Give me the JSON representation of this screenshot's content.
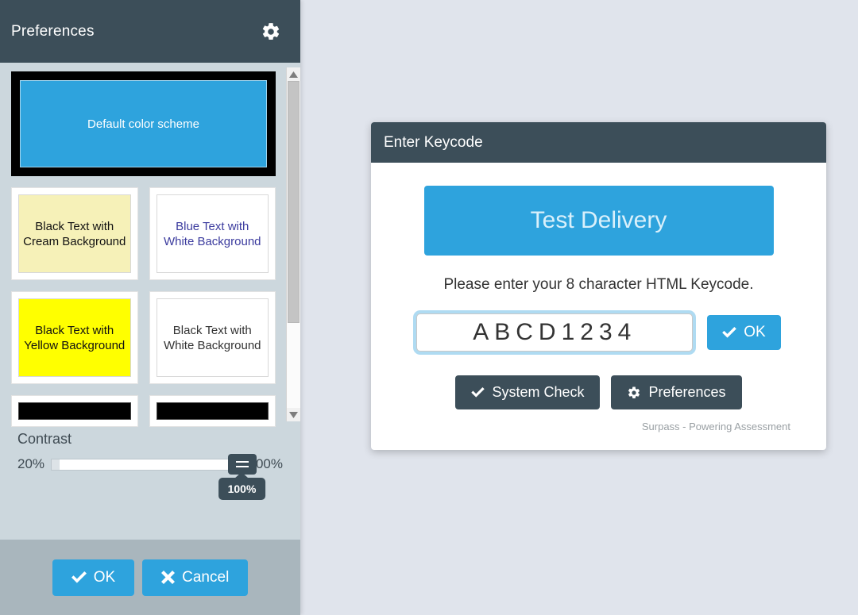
{
  "preferences": {
    "title": "Preferences",
    "gear_icon": "gear-icon",
    "schemes": [
      {
        "label": "Default color scheme",
        "bg": "#2ea3dd",
        "fg": "#ffffff",
        "selected": true
      },
      {
        "label": "Black Text with Cream Background",
        "bg": "#f6f1b8",
        "fg": "#111111",
        "selected": false
      },
      {
        "label": "Blue Text with White Background",
        "bg": "#ffffff",
        "fg": "#3b3b9e",
        "selected": false
      },
      {
        "label": "Black Text with Yellow Background",
        "bg": "#ffff00",
        "fg": "#111111",
        "selected": false
      },
      {
        "label": "Black Text with White Background",
        "bg": "#ffffff",
        "fg": "#333333",
        "selected": false
      },
      {
        "label": "",
        "bg": "#000000",
        "fg": "#ffffff",
        "selected": false
      },
      {
        "label": "",
        "bg": "#000000",
        "fg": "#ffffff",
        "selected": false
      }
    ],
    "contrast": {
      "label": "Contrast",
      "min_label": "20%",
      "max_label": "100%",
      "value_label": "100%",
      "value": 100
    },
    "footer": {
      "ok_label": "OK",
      "cancel_label": "Cancel"
    },
    "scrollbar": {
      "up_icon": "chevron-up-icon",
      "down_icon": "chevron-down-icon"
    }
  },
  "keycode_dialog": {
    "title": "Enter Keycode",
    "banner_label": "Test Delivery",
    "instruction": "Please enter your 8 character HTML Keycode.",
    "input_value": "ABCD1234",
    "input_placeholder": "",
    "ok_label": "OK",
    "system_check_label": "System Check",
    "preferences_label": "Preferences",
    "footer_text": "Surpass - Powering Assessment"
  },
  "colors": {
    "accent_blue": "#2ea3dd",
    "dark_slate": "#3c4e59",
    "panel_body": "#ccd7dd",
    "panel_chrome": "#a9b6bd",
    "page_background": "#e0e4ec"
  }
}
